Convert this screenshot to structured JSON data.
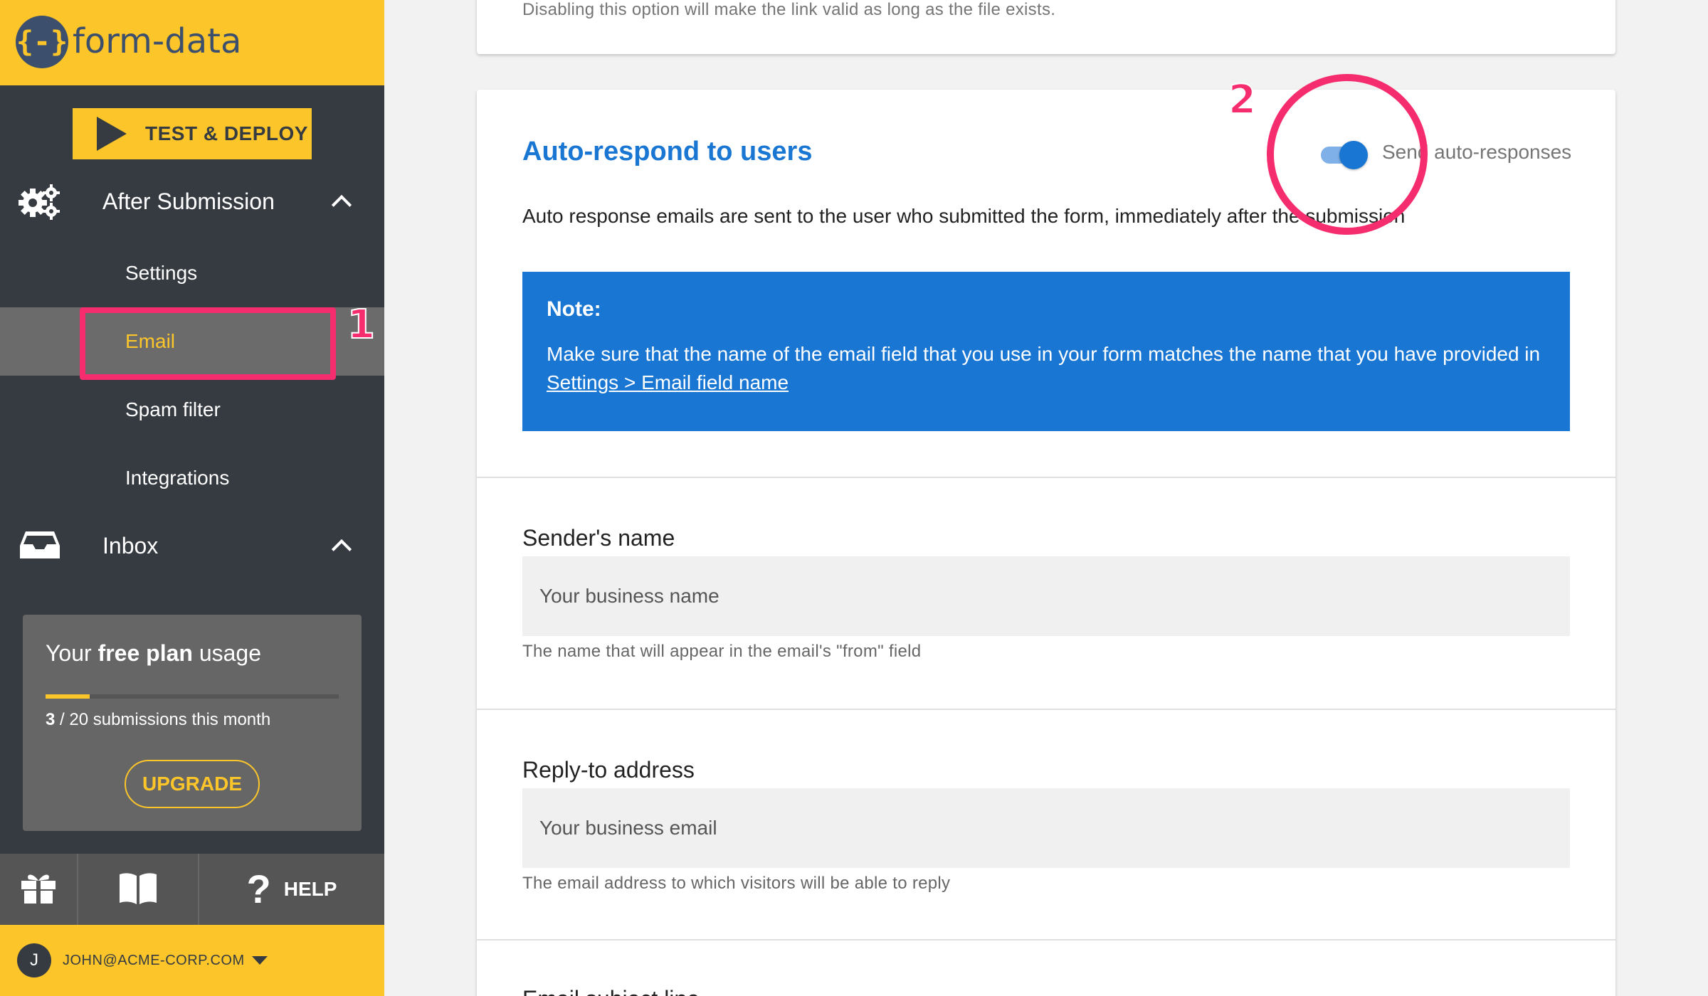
{
  "brand": {
    "logo_glyph": "{-}",
    "name": "form-data"
  },
  "sidebar": {
    "test_deploy_label": "TEST & DEPLOY",
    "sections": [
      {
        "label": "After Submission",
        "icon": "gears-icon",
        "items": [
          {
            "label": "Settings"
          },
          {
            "label": "Email",
            "active": true
          },
          {
            "label": "Spam filter"
          },
          {
            "label": "Integrations"
          }
        ]
      },
      {
        "label": "Inbox",
        "icon": "inbox-icon"
      }
    ],
    "usage": {
      "title_prefix": "Your",
      "title_bold": "free plan",
      "title_suffix": "usage",
      "used": "3",
      "limit_text": "/ 20 submissions this month",
      "fraction": 0.15,
      "upgrade_label": "UPGRADE"
    },
    "bottom": {
      "help_label": "HELP"
    },
    "user": {
      "initial": "J",
      "email": "JOHN@ACME-CORP.COM"
    }
  },
  "annotations": {
    "marker_1": "1",
    "marker_2": "2"
  },
  "main": {
    "top_card_text": "Disabling this option will make the link valid as long as the file exists.",
    "auto_respond": {
      "title": "Auto-respond to users",
      "toggle_label": "Send auto-responses",
      "toggle_on": true,
      "description": "Auto response emails are sent to the user who submitted the form, immediately after the submission",
      "note_title": "Note:",
      "note_body": "Make sure that the name of the email field that you use in your form matches the name that you have provided in",
      "note_link": "Settings > Email field name"
    },
    "fields": [
      {
        "label": "Sender's name",
        "placeholder": "Your business name",
        "help": "The name that will appear in the email's \"from\" field"
      },
      {
        "label": "Reply-to address",
        "placeholder": "Your business email",
        "help": "The email address to which visitors will be able to reply"
      },
      {
        "label": "Email subject line"
      }
    ]
  },
  "colors": {
    "brand_yellow": "#fcc62b",
    "sidebar_dark": "#363b41",
    "primary_blue": "#1976d2",
    "annotation_pink": "#f52d6e"
  }
}
